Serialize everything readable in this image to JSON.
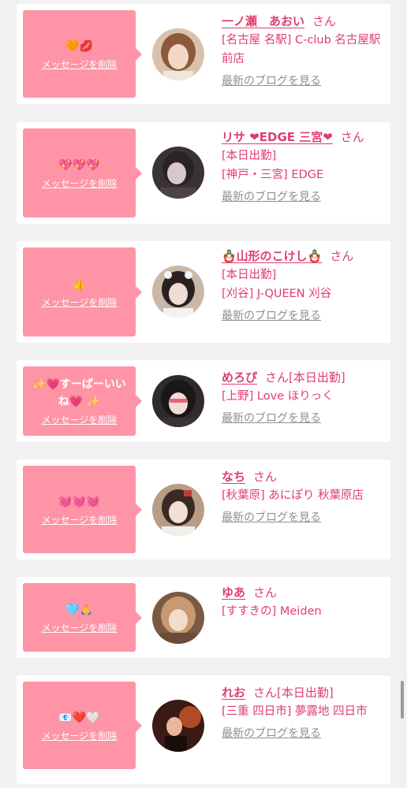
{
  "delete_label": "メッセージを削除",
  "blog_label": "最新のブログを見る",
  "honorific": "さん",
  "colors": {
    "bubble": "#ff94a6",
    "name": "#e03d6d",
    "muted": "#8f8f8f",
    "background": "#f1f1f1"
  },
  "items": [
    {
      "message": "🧡💋",
      "name": "一ノ瀬　あおい",
      "lines": [
        "[名古屋 名駅] C-club 名古屋駅前店"
      ],
      "avatar_icon": "avatar-photo"
    },
    {
      "message": "💖💖💖",
      "name": "リサ ❤EDGE 三宮❤",
      "lines": [
        "[本日出勤]",
        "[神戸・三宮] EDGE"
      ],
      "avatar_icon": "avatar-photo"
    },
    {
      "message": "👍",
      "name": "🪆山形のこけし🪆",
      "lines": [
        "[本日出勤]",
        "[刈谷] J-QUEEN 刈谷"
      ],
      "avatar_icon": "avatar-photo"
    },
    {
      "message": "✨💗すーぱーいいね💗 ✨",
      "name": "めろぴ",
      "inline_status": "[本日出勤]",
      "lines": [
        "[上野] Love ほりっく"
      ],
      "avatar_icon": "avatar-photo"
    },
    {
      "message": "💓💓💓",
      "name": "なち",
      "lines": [
        "[秋葉原] あにぽり 秋葉原店"
      ],
      "avatar_icon": "avatar-photo"
    },
    {
      "message": "🩵🙏",
      "name": "ゆあ",
      "lines": [
        "[すすきの] Meiden"
      ],
      "avatar_icon": "avatar-photo"
    },
    {
      "message": "📧❤️🤍",
      "name": "れお",
      "inline_status": "[本日出勤]",
      "lines": [
        "[三重 四日市] 夢露地 四日市"
      ],
      "avatar_icon": "avatar-photo"
    }
  ]
}
